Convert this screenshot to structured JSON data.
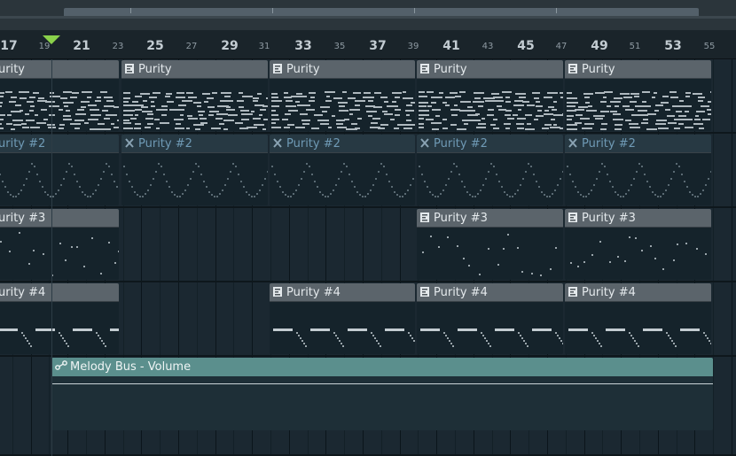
{
  "ruler": {
    "bars": [
      {
        "label": "17",
        "major": true
      },
      {
        "label": "19",
        "major": false
      },
      {
        "label": "21",
        "major": true
      },
      {
        "label": "23",
        "major": false
      },
      {
        "label": "25",
        "major": true
      },
      {
        "label": "27",
        "major": false
      },
      {
        "label": "29",
        "major": true
      },
      {
        "label": "31",
        "major": false
      },
      {
        "label": "33",
        "major": true
      },
      {
        "label": "35",
        "major": false
      },
      {
        "label": "37",
        "major": true
      },
      {
        "label": "39",
        "major": false
      },
      {
        "label": "41",
        "major": true
      },
      {
        "label": "43",
        "major": false
      },
      {
        "label": "45",
        "major": true
      },
      {
        "label": "47",
        "major": false
      },
      {
        "label": "49",
        "major": true
      },
      {
        "label": "51",
        "major": false
      },
      {
        "label": "53",
        "major": true
      },
      {
        "label": "55",
        "major": false
      }
    ]
  },
  "tracks": [
    {
      "id": "purity",
      "muted": false,
      "clips": [
        {
          "label": "urity",
          "icon": "none"
        },
        {
          "label": "Purity",
          "icon": "piano-roll-icon"
        },
        {
          "label": "Purity",
          "icon": "piano-roll-icon"
        },
        {
          "label": "Purity",
          "icon": "piano-roll-icon"
        },
        {
          "label": "Purity",
          "icon": "piano-roll-icon"
        }
      ]
    },
    {
      "id": "purity-2",
      "muted": true,
      "clips": [
        {
          "label": "urity #2",
          "icon": "none"
        },
        {
          "label": "Purity #2",
          "icon": "muted-x-icon"
        },
        {
          "label": "Purity #2",
          "icon": "muted-x-icon"
        },
        {
          "label": "Purity #2",
          "icon": "muted-x-icon"
        },
        {
          "label": "Purity #2",
          "icon": "muted-x-icon"
        }
      ]
    },
    {
      "id": "purity-3",
      "muted": false,
      "clips": [
        {
          "label": "urity #3",
          "icon": "none"
        },
        {
          "label": "Purity #3",
          "icon": "piano-roll-icon"
        },
        {
          "label": "Purity #3",
          "icon": "piano-roll-icon"
        }
      ]
    },
    {
      "id": "purity-4",
      "muted": false,
      "clips": [
        {
          "label": "urity #4",
          "icon": "none"
        },
        {
          "label": "Purity #4",
          "icon": "piano-roll-icon"
        },
        {
          "label": "Purity #4",
          "icon": "piano-roll-icon"
        },
        {
          "label": "Purity #4",
          "icon": "piano-roll-icon"
        }
      ]
    }
  ],
  "automation": {
    "label": "Melody Bus - Volume",
    "icon": "automation-icon"
  },
  "colors": {
    "clip_header": "#5b646b",
    "muted_header": "#273943",
    "automation_header": "#5b8f8d",
    "playhead": "#8ad14b"
  }
}
